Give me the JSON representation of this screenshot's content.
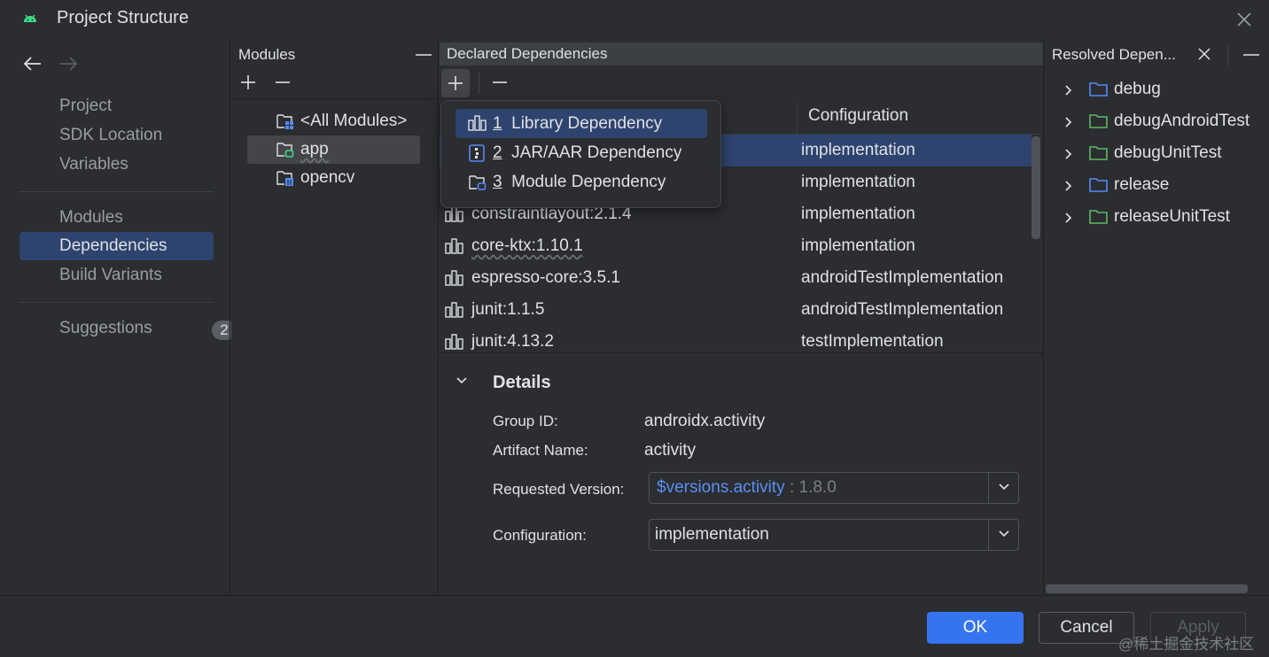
{
  "window": {
    "title": "Project Structure"
  },
  "nav": {
    "items": [
      {
        "label": "Project"
      },
      {
        "label": "SDK Location"
      },
      {
        "label": "Variables"
      },
      {
        "label": "Modules"
      },
      {
        "label": "Dependencies"
      },
      {
        "label": "Build Variants"
      },
      {
        "label": "Suggestions",
        "badge": "2"
      }
    ],
    "selected": "Dependencies"
  },
  "modules": {
    "header": "Modules",
    "items": [
      {
        "label": "<All Modules>",
        "icon": "all-modules-icon"
      },
      {
        "label": "app",
        "icon": "app-module-icon"
      },
      {
        "label": "opencv",
        "icon": "library-module-icon"
      }
    ],
    "selected": "app"
  },
  "declared": {
    "header": "Declared Dependencies",
    "column_config": "Configuration",
    "rows": [
      {
        "library": "",
        "config": "implementation"
      },
      {
        "library": "",
        "config": "implementation"
      },
      {
        "library": "constraintlayout:2.1.4",
        "config": "implementation"
      },
      {
        "library": "core-ktx:1.10.1",
        "config": "implementation"
      },
      {
        "library": "espresso-core:3.5.1",
        "config": "androidTestImplementation"
      },
      {
        "library": "junit:1.1.5",
        "config": "androidTestImplementation"
      },
      {
        "library": "junit:4.13.2",
        "config": "testImplementation"
      }
    ]
  },
  "popup": {
    "items": [
      {
        "num": "1",
        "label": "Library Dependency"
      },
      {
        "num": "2",
        "label": "JAR/AAR Dependency"
      },
      {
        "num": "3",
        "label": "Module Dependency"
      }
    ]
  },
  "details": {
    "title": "Details",
    "group_label": "Group ID:",
    "group_value": "androidx.activity",
    "artifact_label": "Artifact Name:",
    "artifact_value": "activity",
    "version_label": "Requested Version:",
    "version_ref": "$versions.activity",
    "version_resolved": " : 1.8.0",
    "config_label": "Configuration:",
    "config_value": "implementation"
  },
  "resolved": {
    "header": "Resolved Depen...",
    "items": [
      {
        "label": "debug",
        "color": "#548af7"
      },
      {
        "label": "debugAndroidTest",
        "color": "#5fb865"
      },
      {
        "label": "debugUnitTest",
        "color": "#5fb865"
      },
      {
        "label": "release",
        "color": "#548af7"
      },
      {
        "label": "releaseUnitTest",
        "color": "#5fb865"
      }
    ]
  },
  "footer": {
    "ok": "OK",
    "cancel": "Cancel",
    "apply": "Apply",
    "watermark": "@稀土掘金技术社区"
  },
  "colors": {
    "accent": "#3574f0",
    "selection": "#2e436e",
    "android_green": "#3ddc84"
  }
}
